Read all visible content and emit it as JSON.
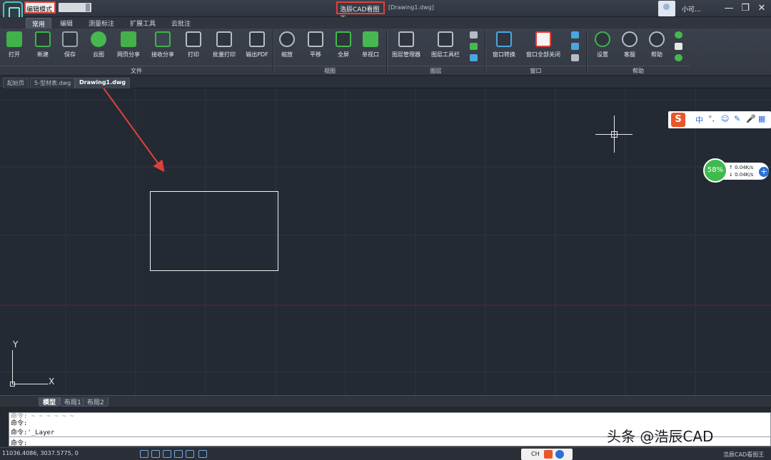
{
  "titlebar": {
    "mode_label": "编辑模式",
    "app_title": "浩辰CAD看图王",
    "document": "[Drawing1.dwg]",
    "user_name": "小可...",
    "min_symbol": "—",
    "max_symbol": "❐",
    "close_symbol": "✕"
  },
  "menu_tabs": [
    "常用",
    "编辑",
    "测量标注",
    "扩展工具",
    "云批注"
  ],
  "mdi_controls": [
    "−",
    "▫",
    "×"
  ],
  "ribbon": {
    "tools": [
      {
        "label": "打开",
        "icon": "folder-open-icon",
        "color": "#3fb24a"
      },
      {
        "label": "新建",
        "icon": "new-file-icon",
        "color": "#3fb24a"
      },
      {
        "label": "保存",
        "icon": "save-icon",
        "color": "#9aa3ae"
      },
      {
        "label": "云图",
        "icon": "cloud-icon",
        "color": "#46b84f"
      },
      {
        "label": "网页分享",
        "icon": "share-icon",
        "color": "#45b04a"
      },
      {
        "label": "接收分享",
        "icon": "receive-share-icon",
        "color": "#45b04a"
      },
      {
        "label": "打印",
        "icon": "printer-icon",
        "color": "#b7bdc5"
      },
      {
        "label": "批量打印",
        "icon": "batch-print-icon",
        "color": "#b7bdc5"
      },
      {
        "label": "输出PDF",
        "icon": "pdf-icon",
        "color": "#b7bdc5"
      },
      {
        "label": "缩放",
        "icon": "zoom-icon",
        "color": "#b7bdc5"
      },
      {
        "label": "平移",
        "icon": "pan-hand-icon",
        "color": "#b7bdc5"
      },
      {
        "label": "全屏",
        "icon": "fullscreen-icon",
        "color": "#46b84f"
      },
      {
        "label": "单视口",
        "icon": "single-viewport-icon",
        "color": "#46b84f"
      },
      {
        "label": "图层管理器",
        "icon": "layer-manager-icon",
        "color": "#b7bdc5"
      },
      {
        "label": "图层工具栏",
        "icon": "layer-toolbar-icon",
        "color": "#b7bdc5"
      },
      {
        "label": "窗口转换",
        "icon": "window-switch-icon",
        "color": "#4aa6e0"
      },
      {
        "label": "窗口全部关闭",
        "icon": "close-all-windows-icon",
        "color": "#e04040"
      },
      {
        "label": "设置",
        "icon": "settings-gear-icon",
        "color": "#3fb24a"
      },
      {
        "label": "客服",
        "icon": "headset-icon",
        "color": "#b7bdc5"
      },
      {
        "label": "帮助",
        "icon": "help-icon",
        "color": "#b7bdc5"
      }
    ],
    "groups": [
      "文件",
      "视图",
      "图层",
      "窗口",
      "帮助"
    ]
  },
  "doc_tabs": [
    "起始页",
    "5-型材表.dwg",
    "Drawing1.dwg"
  ],
  "ime": {
    "logo": "S",
    "items": [
      "中",
      "°,",
      "☺",
      "✎",
      "🎤",
      "▦"
    ]
  },
  "net_monitor": {
    "percent": "58%",
    "upload": "0.04K/s",
    "download": "0.04K/s",
    "add": "+"
  },
  "axis": {
    "y": "Y",
    "x": "X"
  },
  "layout_tabs": [
    "模型",
    "布局1",
    "布局2"
  ],
  "command": {
    "lines": [
      "命令: ~ ~ ~ ~ ~ ~",
      "命令:",
      "命令:'_Layer"
    ],
    "prompt": "命令:"
  },
  "status": {
    "coords": "11036.4086, 3037.5775, 0",
    "tray_lang": "CH",
    "app": "浩辰CAD看图王"
  },
  "watermark": "头条 @浩辰CAD"
}
